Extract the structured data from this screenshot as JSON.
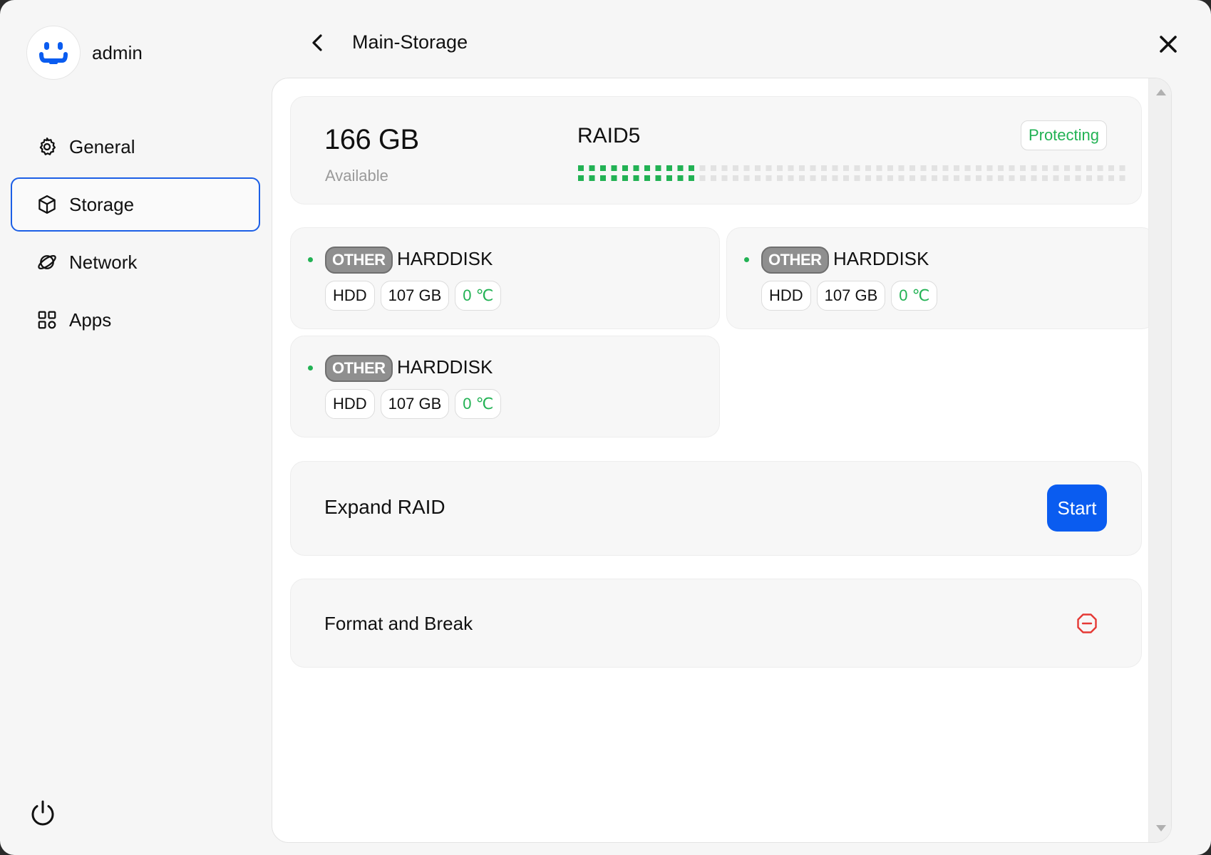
{
  "sidebar": {
    "username": "admin",
    "items": [
      {
        "label": "General",
        "icon": "gear-icon",
        "active": false
      },
      {
        "label": "Storage",
        "icon": "cube-icon",
        "active": true
      },
      {
        "label": "Network",
        "icon": "globe-icon",
        "active": false
      },
      {
        "label": "Apps",
        "icon": "apps-grid-icon",
        "active": false
      }
    ]
  },
  "header": {
    "title": "Main-Storage"
  },
  "summary": {
    "capacity": "166 GB",
    "capacity_label": "Available",
    "raid_type": "RAID5",
    "status": "Protecting",
    "used_fraction": 0.22
  },
  "disks": [
    {
      "type_tag": "OTHER",
      "name": "HARDDISK",
      "media": "HDD",
      "size": "107 GB",
      "temp": "0 ℃"
    },
    {
      "type_tag": "OTHER",
      "name": "HARDDISK",
      "media": "HDD",
      "size": "107 GB",
      "temp": "0 ℃"
    },
    {
      "type_tag": "OTHER",
      "name": "HARDDISK",
      "media": "HDD",
      "size": "107 GB",
      "temp": "0 ℃"
    }
  ],
  "expand": {
    "label": "Expand RAID",
    "button": "Start"
  },
  "format": {
    "label": "Format and Break"
  },
  "colors": {
    "accent": "#0a5cf0",
    "active_border": "#1c5fe6",
    "success": "#22b254",
    "danger": "#e53935",
    "segment_off": "#e2e2e2"
  }
}
